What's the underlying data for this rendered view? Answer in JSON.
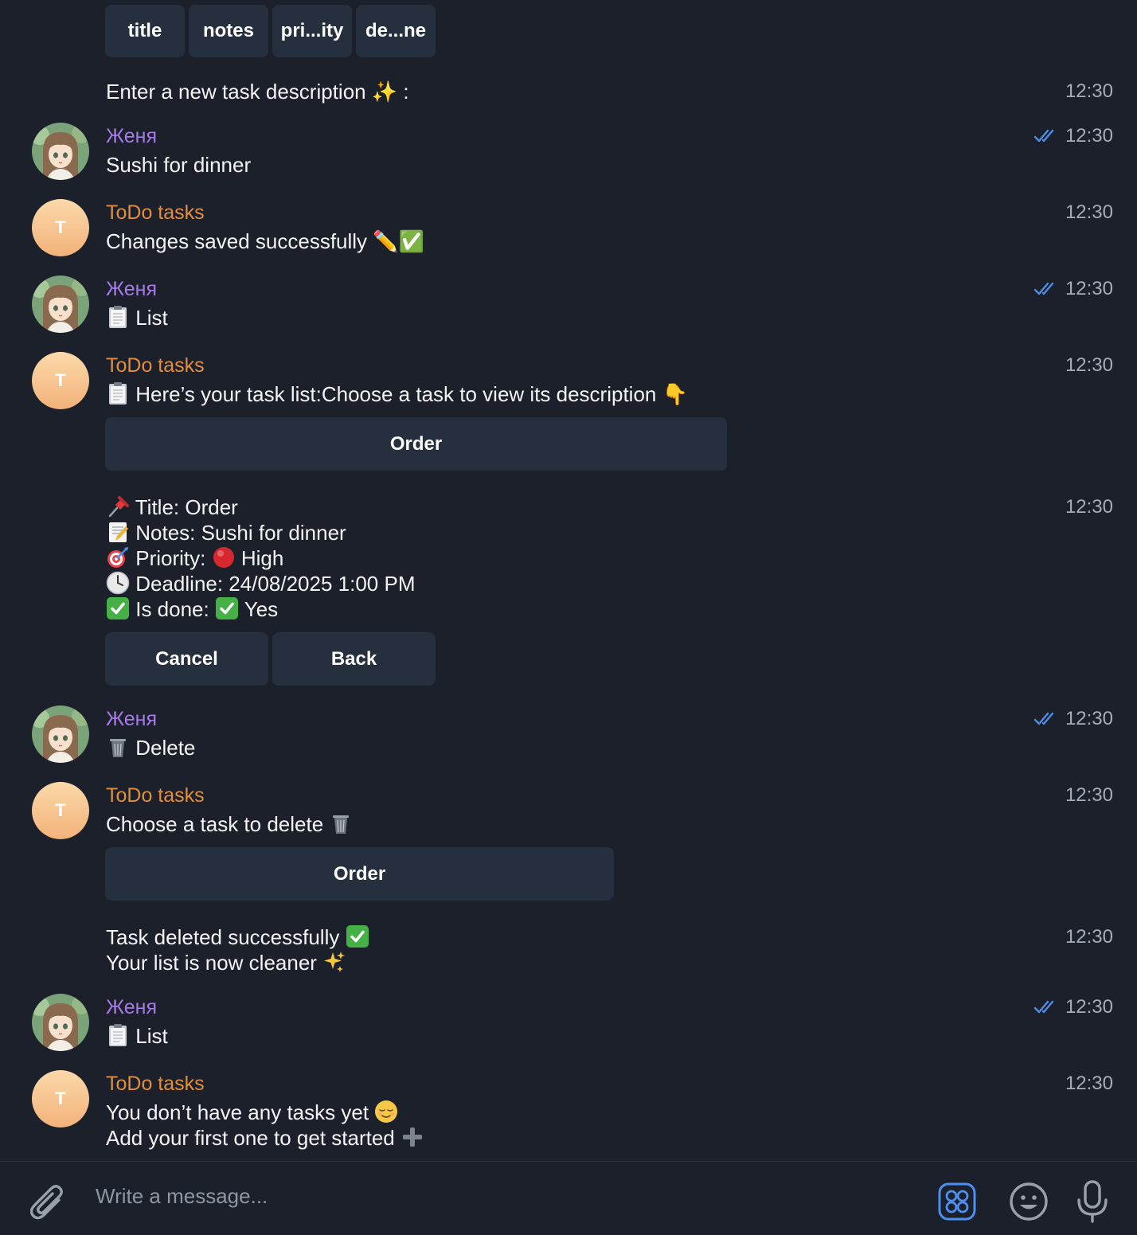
{
  "top_keyboard": {
    "buttons": [
      "title",
      "notes",
      "pri...ity",
      "de...ne"
    ]
  },
  "messages": {
    "prompt_enter": {
      "text": "Enter a new task description ✨ :",
      "time": "12:30"
    },
    "m1": {
      "sender": "Женя",
      "text": "Sushi for dinner",
      "time": "12:30"
    },
    "m2": {
      "sender": "ToDo tasks",
      "avatar_letter": "T",
      "text": "Changes saved successfully ✏️✅",
      "time": "12:30"
    },
    "m3": {
      "sender": "Женя",
      "text": "List",
      "time": "12:30"
    },
    "m4": {
      "sender": "ToDo tasks",
      "avatar_letter": "T",
      "text": "Here’s your task list:Choose a task to view its description 👇",
      "time": "12:30",
      "button": "Order"
    },
    "m5": {
      "time": "12:30",
      "title_line": "Title: Order",
      "notes_line": "Notes: Sushi for dinner",
      "priority_label": "Priority:",
      "priority_value": "High",
      "deadline_line": "Deadline: 24/08/2025 1:00 PM",
      "done_label": "Is done:",
      "done_value": "Yes",
      "buttons": {
        "cancel": "Cancel",
        "back": "Back"
      }
    },
    "m6": {
      "sender": "Женя",
      "text": "Delete",
      "time": "12:30"
    },
    "m7": {
      "sender": "ToDo tasks",
      "avatar_letter": "T",
      "text": "Choose a task to delete",
      "time": "12:30",
      "button": "Order"
    },
    "m8": {
      "line1": "Task deleted successfully",
      "line2": "Your list is now cleaner",
      "time": "12:30"
    },
    "m9": {
      "sender": "Женя",
      "text": "List",
      "time": "12:30"
    },
    "m10": {
      "sender": "ToDo tasks",
      "avatar_letter": "T",
      "line1": "You don’t have any tasks yet",
      "line2": "Add your first one to get started",
      "time": "12:30"
    }
  },
  "composer": {
    "placeholder": "Write a message..."
  },
  "icons": [
    "attach-icon",
    "bot-menu-icon",
    "emoji-icon",
    "microphone-icon"
  ],
  "colors": {
    "background": "#1b202b",
    "user_name": "#a779e9",
    "bot_name": "#e38e3a",
    "read_ticks": "#4c8ff0",
    "button_bg": "#262f3e"
  }
}
